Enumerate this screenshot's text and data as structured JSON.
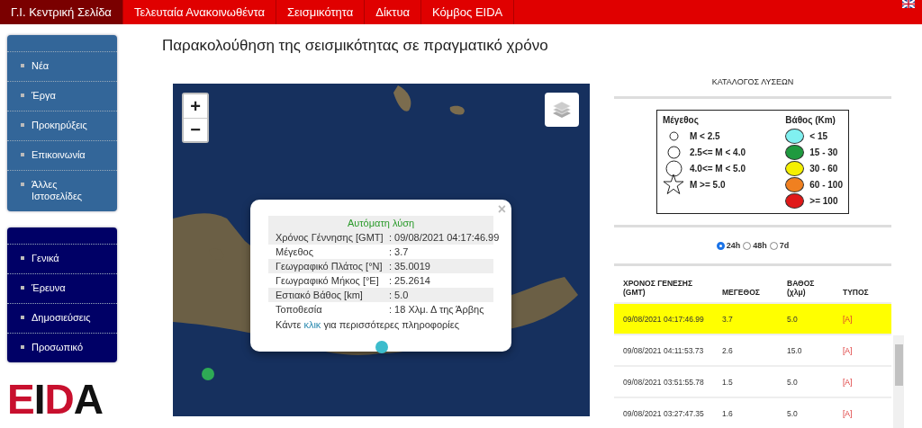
{
  "nav": {
    "items": [
      {
        "label": "Γ.Ι. Κεντρική Σελίδα",
        "selected": true
      },
      {
        "label": "Τελευταία Ανακοινωθέντα",
        "selected": false
      },
      {
        "label": "Σεισμικότητα",
        "selected": false
      },
      {
        "label": "Δίκτυα",
        "selected": false
      },
      {
        "label": "Κόμβος EIDA",
        "selected": false
      }
    ]
  },
  "sidebar": {
    "menus": [
      {
        "kind": "light",
        "items": [
          {
            "label": "Νέα"
          },
          {
            "label": "Έργα"
          },
          {
            "label": "Προκηρύξεις"
          },
          {
            "label": "Επικοινωνία"
          },
          {
            "label": "Άλλες Ιστοσελίδες"
          }
        ]
      },
      {
        "kind": "dark",
        "items": [
          {
            "label": "Γενικά"
          },
          {
            "label": "Έρευνα"
          },
          {
            "label": "Δημοσιεύσεις"
          },
          {
            "label": "Προσωπικό"
          }
        ]
      }
    ],
    "logo": "EIDA"
  },
  "page_title": "Παρακολούθηση της σεισμικότητας σε πραγματικό χρόνο",
  "map": {
    "zoom_in": "+",
    "zoom_out": "−",
    "markers": [
      {
        "color": "#3cbccc"
      },
      {
        "color": "#2eaa55"
      }
    ],
    "popup": {
      "heading": "Αυτόματη λύση",
      "close": "×",
      "rows": [
        {
          "label": "Χρόνος Γέννησης [GMT]",
          "value": ": 09/08/2021 04:17:46.99"
        },
        {
          "label": "Μέγεθος",
          "value": ": 3.7"
        },
        {
          "label": "Γεωγραφικό Πλάτος [°N]",
          "value": ": 35.0019"
        },
        {
          "label": "Γεωγραφικό Μήκος [°E]",
          "value": ": 25.2614"
        },
        {
          "label": "Εστιακό Βάθος [km]",
          "value": ": 5.0"
        },
        {
          "label": "Τοποθεσία",
          "value": ": 18 Χλμ. Δ της Άρβης"
        }
      ],
      "more_info": {
        "before": "Κάντε",
        "link": "κλικ",
        "after": "για περισσότερες πληροφορίες"
      }
    }
  },
  "catalog": {
    "title": "ΚΑΤΑΛΟΓΟΣ ΛΥΣΕΩΝ",
    "legend": {
      "magnitude_title": "Μέγεθος",
      "depth_title": "Βάθος (Km)",
      "magnitude_items": [
        {
          "kind": "small",
          "label": "M < 2.5"
        },
        {
          "kind": "medium",
          "label": "2.5<= M < 4.0"
        },
        {
          "kind": "large",
          "label": "4.0<= M < 5.0"
        },
        {
          "kind": "star",
          "label": "M >= 5.0"
        }
      ],
      "depth_items": [
        {
          "color": "#80f0f0",
          "label": "< 15"
        },
        {
          "color": "#1f9a3f",
          "label": "15 - 30"
        },
        {
          "color": "#f5f000",
          "label": "30 - 60"
        },
        {
          "color": "#f08020",
          "label": "60 - 100"
        },
        {
          "color": "#e01818",
          "label": ">= 100"
        }
      ]
    },
    "periods": [
      {
        "label": "24h",
        "selected": true
      },
      {
        "label": "48h",
        "selected": false
      },
      {
        "label": "7d",
        "selected": false
      }
    ],
    "table": {
      "columns": [
        "ΧΡΟΝΟΣ ΓΕΝΕΣΗΣ (GMT)",
        "ΜΕΓΕΘΟΣ",
        "ΒΑΘΟΣ (χλμ)",
        "ΤΥΠΟΣ"
      ],
      "rows": [
        {
          "selected": true,
          "cells": [
            "09/08/2021 04:17:46.99",
            "3.7",
            "5.0",
            "[A]"
          ]
        },
        {
          "selected": false,
          "cells": [
            "09/08/2021 04:11:53.73",
            "2.6",
            "15.0",
            "[A]"
          ]
        },
        {
          "selected": false,
          "cells": [
            "09/08/2021 03:51:55.78",
            "1.5",
            "5.0",
            "[A]"
          ]
        },
        {
          "selected": false,
          "cells": [
            "09/08/2021 03:27:47.35",
            "1.6",
            "5.0",
            "[A]"
          ]
        }
      ]
    }
  }
}
